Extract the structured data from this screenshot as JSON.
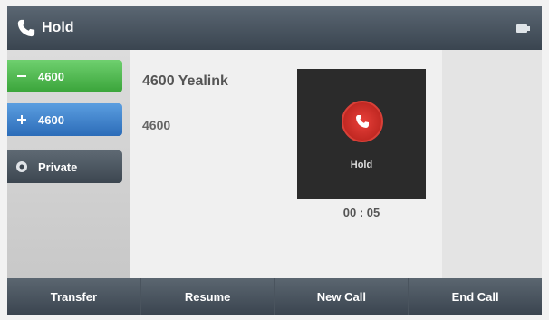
{
  "titlebar": {
    "title": "Hold",
    "phone_icon": "phone-handset-icon",
    "signal_icon": "network-status-icon"
  },
  "linekeys": [
    {
      "label": "4600",
      "icon": "line-icon",
      "color": "#3aa43a"
    },
    {
      "label": "4600",
      "icon": "plus-icon",
      "color": "#2c6cb8"
    },
    {
      "label": "Private",
      "icon": "settings-icon",
      "color": "#3c4650"
    }
  ],
  "call": {
    "caller_name": "4600 Yealink",
    "caller_number": "4600",
    "status_label": "Hold",
    "status_icon": "hold-icon",
    "status_color": "#d84038",
    "timer": "00 : 05"
  },
  "softkeys": [
    {
      "label": "Transfer"
    },
    {
      "label": "Resume"
    },
    {
      "label": "New Call"
    },
    {
      "label": "End Call"
    }
  ]
}
